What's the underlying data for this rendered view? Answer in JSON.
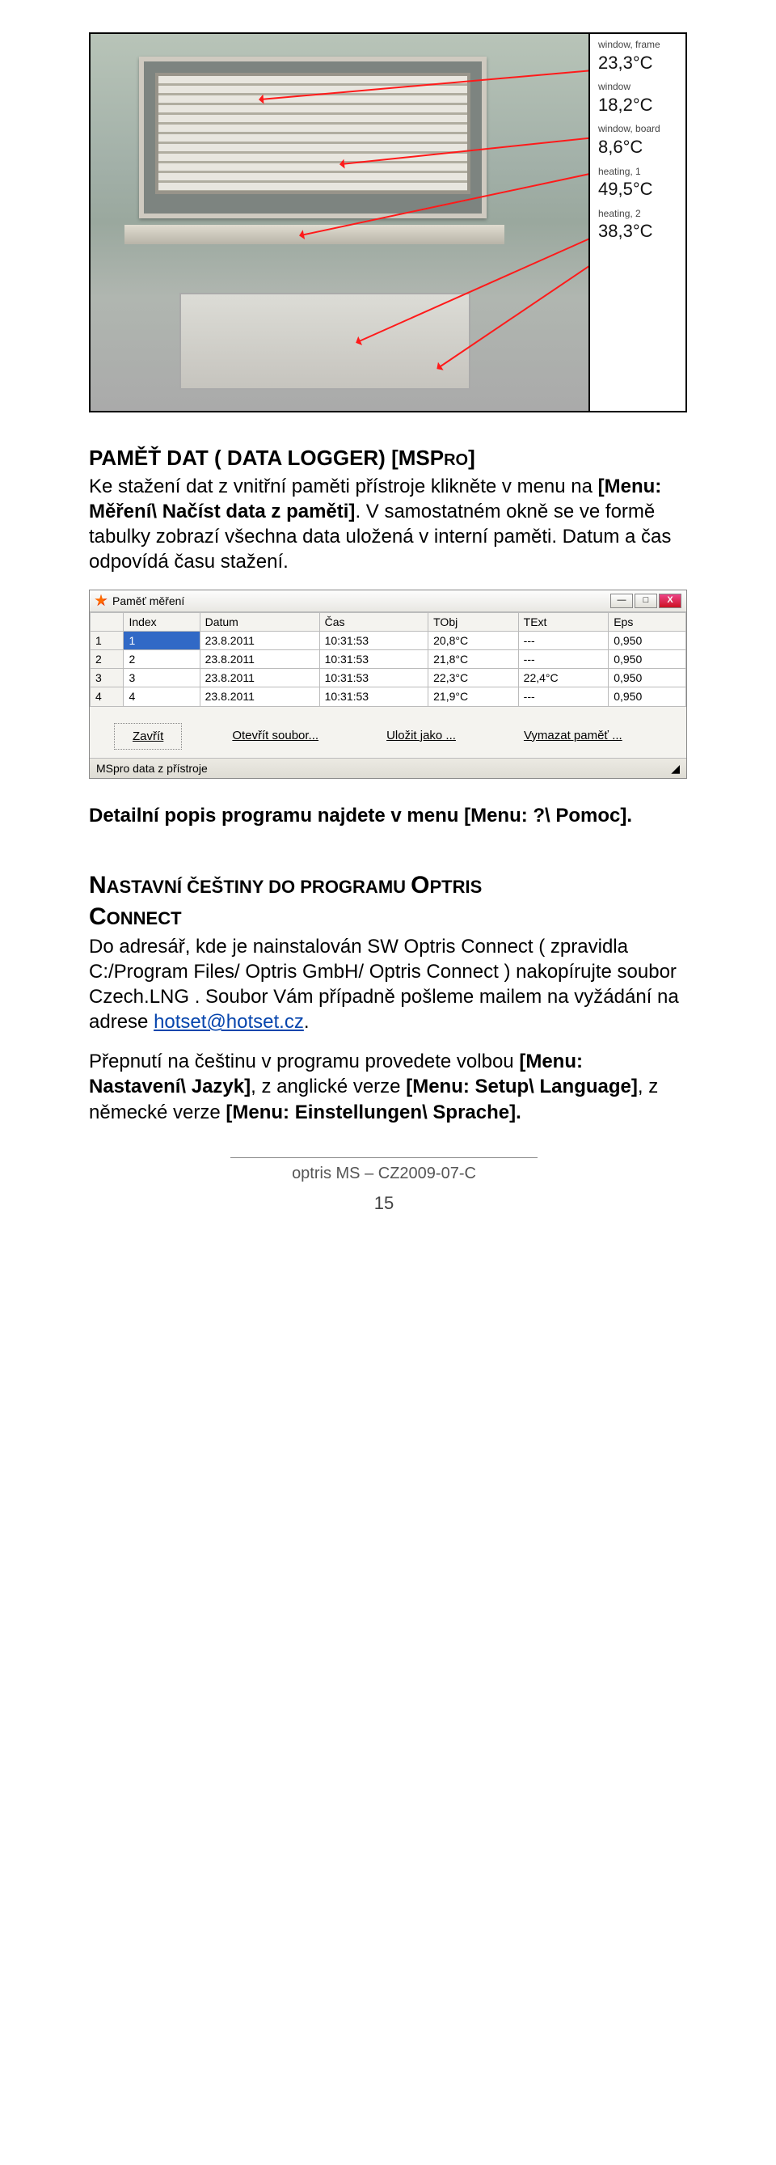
{
  "thermal": {
    "readings": [
      {
        "label": "window, frame",
        "value": "23,3°C"
      },
      {
        "label": "window",
        "value": "18,2°C"
      },
      {
        "label": "window, board",
        "value": "8,6°C"
      },
      {
        "label": "heating, 1",
        "value": "49,5°C"
      },
      {
        "label": "heating, 2",
        "value": "38,3°C"
      }
    ]
  },
  "section1": {
    "heading_prefix": "PAMĚŤ DAT ( DATA LOGGER) [MSP",
    "heading_suffix_small": "RO",
    "heading_end": "]",
    "para": "Ke stažení dat z vnitřní paměti přístroje klikněte v menu na ",
    "menu_ref": "[Menu: Měření\\ Načíst data z paměti]",
    "para2": ". V samostatném okně se ve formě tabulky zobrazí všechna data uložená v interní paměti. Datum a čas odpovídá času stažení."
  },
  "mem_window": {
    "title": "Paměť měření",
    "columns": [
      "Index",
      "Datum",
      "Čas",
      "TObj",
      "TExt",
      "Eps"
    ],
    "rows": [
      [
        "1",
        "23.8.2011",
        "10:31:53",
        "20,8°C",
        "---",
        "0,950"
      ],
      [
        "2",
        "23.8.2011",
        "10:31:53",
        "21,8°C",
        "---",
        "0,950"
      ],
      [
        "3",
        "23.8.2011",
        "10:31:53",
        "22,3°C",
        "22,4°C",
        "0,950"
      ],
      [
        "4",
        "23.8.2011",
        "10:31:53",
        "21,9°C",
        "---",
        "0,950"
      ]
    ],
    "row_labels": [
      "1",
      "2",
      "3",
      "4"
    ],
    "buttons": {
      "close": "Zavřít",
      "open": "Otevřít soubor...",
      "save": "Uložit jako ...",
      "clear": "Vymazat paměť ..."
    },
    "status": "MSpro data z přístroje",
    "win_min": "—",
    "win_max": "□",
    "win_close": "X"
  },
  "detail_line": {
    "text": "Detailní popis programu najdete v menu ",
    "menu": "[Menu: ?\\ Pomoc]."
  },
  "czech_section": {
    "h_line1_caps": "N",
    "h_line1_rest": "ASTAVNÍ ČEŠTINY DO PROGRAMU ",
    "h_opt_caps": "O",
    "h_opt_rest": "PTRIS",
    "h_line2_caps": "C",
    "h_line2_rest": "ONNECT",
    "p1": "Do adresář, kde je nainstalován SW Optris Connect ( zpravidla C:/Program Files/ Optris GmbH/ Optris Connect ) nakopírujte soubor Czech.LNG . Soubor Vám případně pošleme mailem na vyžádání na adrese ",
    "mail": "hotset@hotset.cz",
    "p1_end": ".",
    "p2_a": "Přepnutí na češtinu v programu provedete volbou ",
    "m1": "[Menu: Nastavení\\ Jazyk]",
    "p2_b": ", z anglické verze ",
    "m2": "[Menu: Setup\\ Language]",
    "p2_c": ", z německé verze ",
    "m3": "[Menu: Einstellungen\\ Sprache].",
    "p2_d": ""
  },
  "footer": {
    "code": "optris MS – CZ2009-07-C",
    "page": "15"
  }
}
